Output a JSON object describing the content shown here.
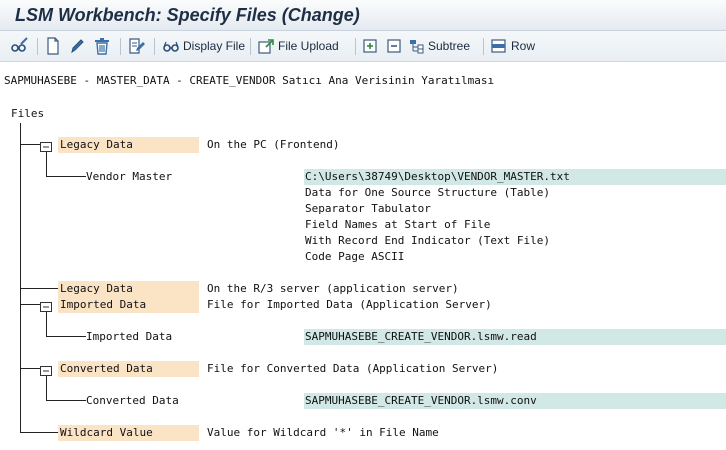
{
  "window": {
    "title": "LSM Workbench: Specify Files (Change)"
  },
  "toolbar": {
    "display_file": "Display File",
    "file_upload": "File Upload",
    "subtree": "Subtree",
    "row": "Row"
  },
  "header": {
    "text": "SAPMUHASEBE - MASTER_DATA - CREATE_VENDOR Satıcı Ana Verisinin Yaratılması"
  },
  "tree": {
    "root": "Files",
    "legacy_pc": {
      "label": "Legacy Data",
      "desc": "On the PC (Frontend)",
      "child": {
        "label": "Vendor Master",
        "path": "C:\\Users\\38749\\Desktop\\VENDOR_MASTER.txt",
        "props": [
          "Data for One Source Structure (Table)",
          "Separator Tabulator",
          "Field Names at Start of File",
          "With Record End Indicator (Text File)",
          "Code Page ASCII"
        ]
      }
    },
    "legacy_r3": {
      "label": "Legacy Data",
      "desc": "On the R/3 server (application server)"
    },
    "imported": {
      "label": "Imported Data",
      "desc": "File for Imported Data (Application Server)",
      "child": {
        "label": "Imported Data",
        "path": "SAPMUHASEBE_CREATE_VENDOR.lsmw.read"
      }
    },
    "converted": {
      "label": "Converted Data",
      "desc": "File for Converted Data (Application Server)",
      "child": {
        "label": "Converted Data",
        "path": "SAPMUHASEBE_CREATE_VENDOR.lsmw.conv"
      }
    },
    "wildcard": {
      "label": "Wildcard Value",
      "desc": "Value for Wildcard '*' in File Name"
    }
  }
}
